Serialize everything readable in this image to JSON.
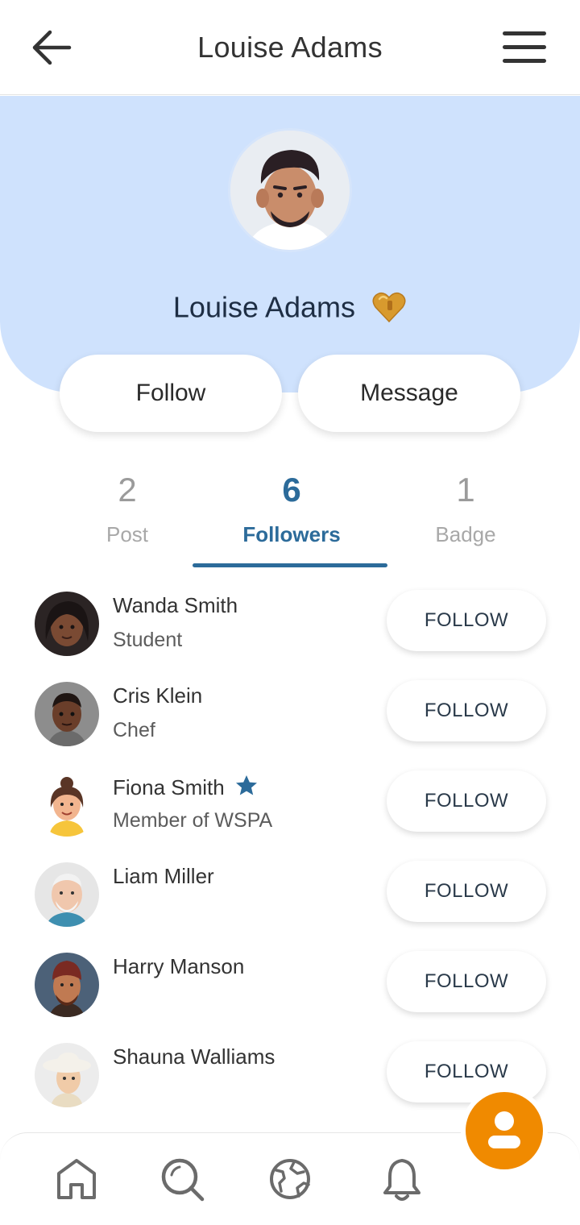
{
  "header": {
    "title": "Louise Adams"
  },
  "profile": {
    "name": "Louise Adams",
    "follow_label": "Follow",
    "message_label": "Message",
    "hero_color": "#cfe2fd"
  },
  "stats": [
    {
      "value": "2",
      "label": "Post"
    },
    {
      "value": "6",
      "label": "Followers"
    },
    {
      "value": "1",
      "label": "Badge"
    }
  ],
  "active_tab": "Followers",
  "followers": [
    {
      "name": "Wanda Smith",
      "subtitle": "Student",
      "button": "FOLLOW",
      "avatar": "avatar-woman-dark-hair"
    },
    {
      "name": "Cris Klein",
      "subtitle": "Chef",
      "button": "FOLLOW",
      "avatar": "avatar-man-short-hair"
    },
    {
      "name": "Fiona Smith",
      "subtitle": "Member of WSPA",
      "button": "FOLLOW",
      "avatar": "avatar-woman-bun",
      "verified_icon": "star-icon"
    },
    {
      "name": "Liam Miller",
      "subtitle": "",
      "button": "FOLLOW",
      "avatar": "avatar-older-man-beard"
    },
    {
      "name": "Harry Manson",
      "subtitle": "",
      "button": "FOLLOW",
      "avatar": "avatar-man-beanie"
    },
    {
      "name": "Shauna Walliams",
      "subtitle": "",
      "button": "FOLLOW",
      "avatar": "avatar-woman-hat"
    }
  ],
  "bottom_nav": [
    "home-icon",
    "search-icon",
    "globe-icon",
    "bell-icon"
  ],
  "fab_icon": "profile-icon",
  "colors": {
    "accent": "#2c6b9a",
    "fab": "#f08a00",
    "star": "#2c6b9a"
  }
}
